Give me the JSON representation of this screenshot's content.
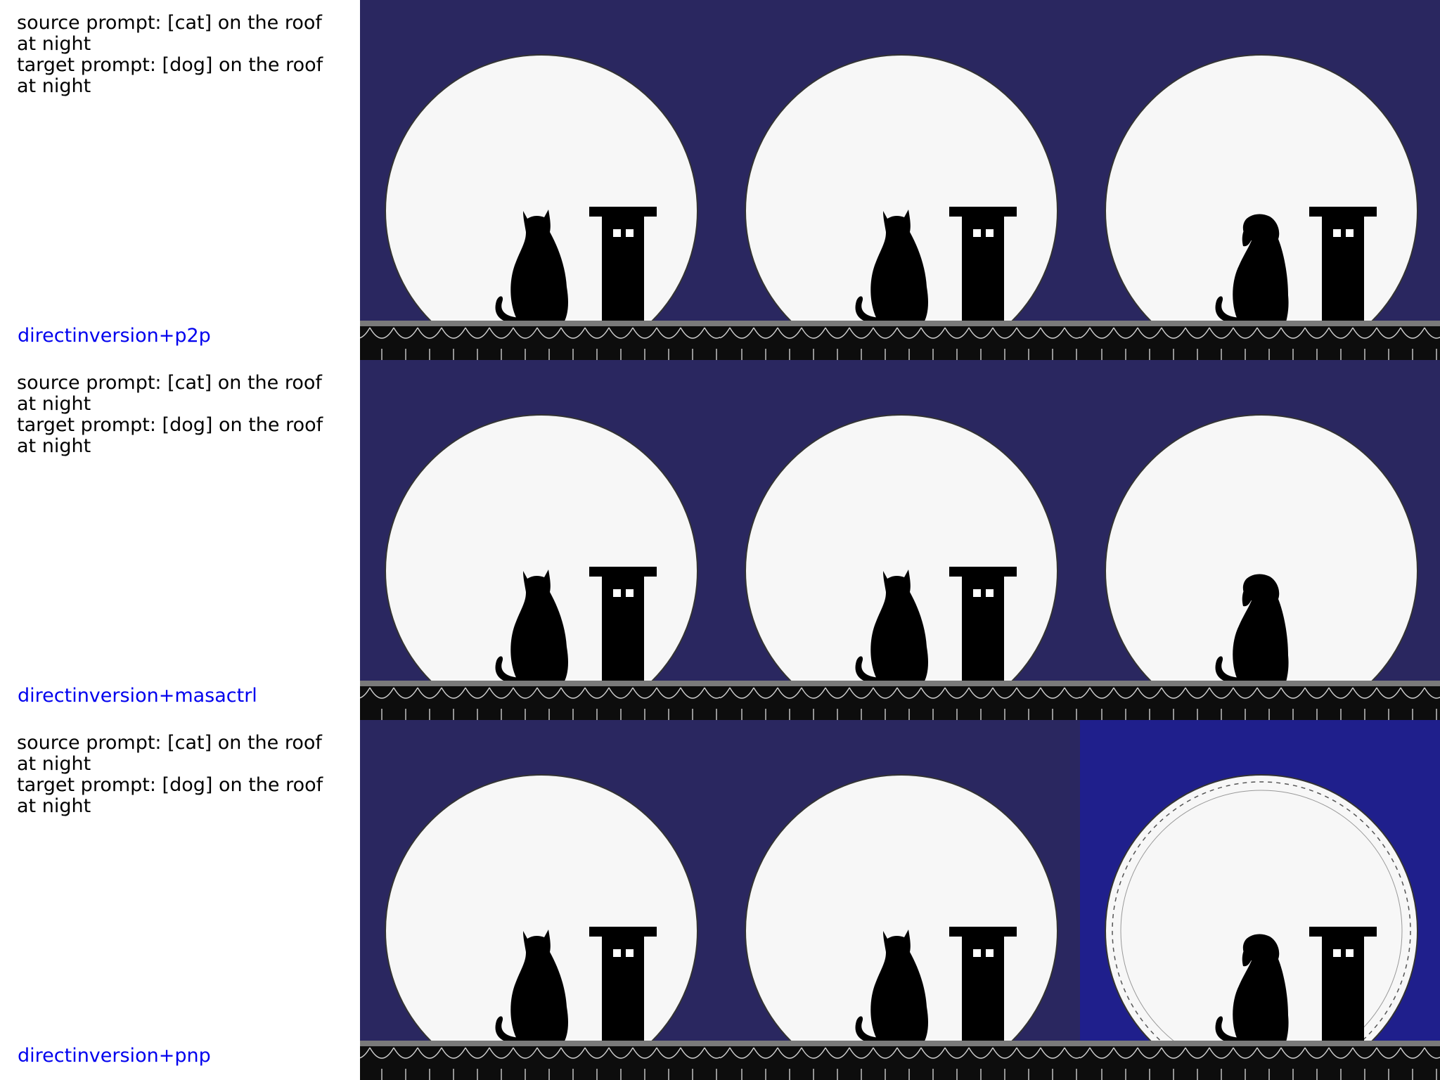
{
  "rows": [
    {
      "source_prompt": "source prompt: [cat] on the roof at night",
      "target_prompt": "target prompt: [dog] on the roof at night",
      "method": "directinversion+p2p",
      "tiles": [
        {
          "subject": "cat",
          "style": "standard"
        },
        {
          "subject": "cat",
          "style": "standard"
        },
        {
          "subject": "dog",
          "style": "standard"
        }
      ]
    },
    {
      "source_prompt": "source prompt: [cat] on the roof at night",
      "target_prompt": "target prompt: [dog] on the roof at night",
      "method": "directinversion+masactrl",
      "tiles": [
        {
          "subject": "cat",
          "style": "standard"
        },
        {
          "subject": "cat",
          "style": "standard"
        },
        {
          "subject": "dog",
          "style": "no-chimney"
        }
      ]
    },
    {
      "source_prompt": "source prompt: [cat] on the roof at night",
      "target_prompt": "target prompt: [dog] on the roof at night",
      "method": "directinversion+pnp",
      "tiles": [
        {
          "subject": "cat",
          "style": "standard"
        },
        {
          "subject": "cat",
          "style": "standard"
        },
        {
          "subject": "dog",
          "style": "blue"
        }
      ]
    }
  ],
  "colors": {
    "sky": "#2a2760",
    "sky_blue": "#1f1f8c",
    "moon": "#f7f7f7",
    "silhouette": "#000000",
    "roof_edge": "#7a7a7a",
    "method_label": "#0000ee"
  }
}
